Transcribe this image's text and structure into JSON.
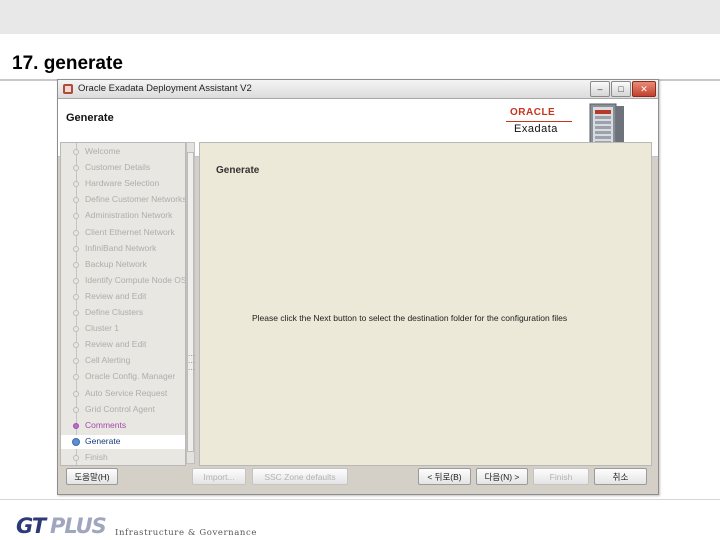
{
  "slide": {
    "title": "17. generate",
    "footer_logo_a": "GT",
    "footer_logo_b": "PLUS",
    "footer_tagline": "Infrastructure & Governance"
  },
  "window": {
    "title": "Oracle Exadata Deployment Assistant V2",
    "controls": {
      "minimize": "–",
      "maximize": "□",
      "close": "✕"
    },
    "header_title": "Generate",
    "logo_text": "ORACLE",
    "product_text": "Exadata"
  },
  "steps": [
    {
      "label": "Welcome",
      "state": "pending"
    },
    {
      "label": "Customer Details",
      "state": "pending"
    },
    {
      "label": "Hardware Selection",
      "state": "pending"
    },
    {
      "label": "Define Customer Networks",
      "state": "pending"
    },
    {
      "label": "Administration Network",
      "state": "pending"
    },
    {
      "label": "Client Ethernet Network",
      "state": "pending"
    },
    {
      "label": "InfiniBand Network",
      "state": "pending"
    },
    {
      "label": "Backup Network",
      "state": "pending"
    },
    {
      "label": "Identify Compute Node OS",
      "state": "pending"
    },
    {
      "label": "Review and Edit",
      "state": "pending"
    },
    {
      "label": "Define Clusters",
      "state": "pending"
    },
    {
      "label": "Cluster 1",
      "state": "pending"
    },
    {
      "label": "Review and Edit",
      "state": "pending"
    },
    {
      "label": "Cell Alerting",
      "state": "pending"
    },
    {
      "label": "Oracle Config. Manager",
      "state": "pending"
    },
    {
      "label": "Auto Service Request",
      "state": "pending"
    },
    {
      "label": "Grid Control Agent",
      "state": "pending"
    },
    {
      "label": "Comments",
      "state": "done"
    },
    {
      "label": "Generate",
      "state": "current"
    },
    {
      "label": "Finish",
      "state": "pending"
    }
  ],
  "content": {
    "heading": "Generate",
    "message": "Please click the Next button to select the destination folder for the configuration files"
  },
  "buttons": {
    "help": "도움말(H)",
    "import": "Import...",
    "ssc_defaults": "SSC Zone defaults",
    "back": "< 뒤로(B)",
    "next": "다음(N) >",
    "finish": "Finish",
    "cancel": "취소"
  },
  "colors": {
    "accent_oracle": "#c9341b",
    "step_done": "#a349b0",
    "step_current": "#5e8ed0",
    "logo_primary": "#2c3a78"
  }
}
